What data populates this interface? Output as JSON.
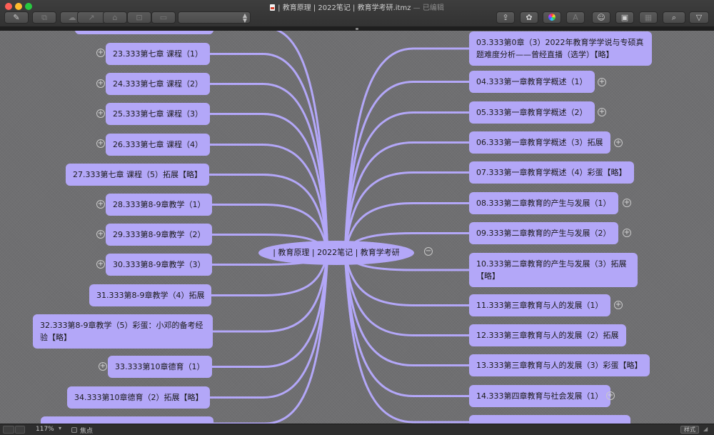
{
  "window": {
    "title": "| 教育原理 | 2022笔记 | 教育学考研.itmz",
    "edited": "— 已编辑"
  },
  "toolbar": {
    "left_icons": [
      "note-icon",
      "map-style-icon",
      "cloud-icon",
      "link-icon",
      "label-icon",
      "callout-icon",
      "comment-icon"
    ],
    "style_select_value": "",
    "right_icons": [
      "share-icon",
      "theme-icon",
      "color-wheel-icon",
      "font-icon",
      "emoji-icon",
      "image-icon",
      "table-icon",
      "search-icon",
      "filter-icon"
    ]
  },
  "mindmap": {
    "central": "| 教育原理 | 2022笔记 | 教育学考研",
    "left_topics": [
      {
        "text": "23.333第七章 课程（1）",
        "collapsed": true
      },
      {
        "text": "24.333第七章 课程（2）",
        "collapsed": true
      },
      {
        "text": "25.333第七章 课程（3）",
        "collapsed": true
      },
      {
        "text": "26.333第七章 课程（4）",
        "collapsed": true
      },
      {
        "text": "27.333第七章 课程（5）拓展【略】",
        "collapsed": false
      },
      {
        "text": "28.333第8-9章教学（1）",
        "collapsed": true
      },
      {
        "text": "29.333第8-9章教学（2）",
        "collapsed": true
      },
      {
        "text": "30.333第8-9章教学（3）",
        "collapsed": true
      },
      {
        "text": "31.333第8-9章教学（4）拓展",
        "collapsed": false
      },
      {
        "text": "32.333第8-9章教学（5）彩蛋：小邓的备考经验【略】",
        "collapsed": false
      },
      {
        "text": "33.333第10章德育（1）",
        "collapsed": true
      },
      {
        "text": "34.333第10章德育（2）拓展【略】",
        "collapsed": false
      }
    ],
    "right_topics": [
      {
        "text": "03.333第0章（3）2022年教育学学说与专硕真题难度分析——曾经直播（选学）【略】",
        "collapsed": false
      },
      {
        "text": "04.333第一章教育学概述（1）",
        "collapsed": true
      },
      {
        "text": "05.333第一章教育学概述（2）",
        "collapsed": true
      },
      {
        "text": "06.333第一章教育学概述（3）拓展",
        "collapsed": true
      },
      {
        "text": "07.333第一章教育学概述（4）彩蛋【略】",
        "collapsed": false
      },
      {
        "text": "08.333第二章教育的产生与发展（1）",
        "collapsed": true
      },
      {
        "text": "09.333第二章教育的产生与发展（2）",
        "collapsed": true
      },
      {
        "text": "10.333第二章教育的产生与发展（3）拓展【略】",
        "collapsed": false
      },
      {
        "text": "11.333第三章教育与人的发展（1）",
        "collapsed": true
      },
      {
        "text": "12.333第三章教育与人的发展（2）拓展",
        "collapsed": false
      },
      {
        "text": "13.333第三章教育与人的发展（3）彩蛋【略】",
        "collapsed": false
      },
      {
        "text": "14.333第四章教育与社会发展（1）",
        "collapsed": true
      }
    ],
    "branch_color": "#b3a7f8"
  },
  "statusbar": {
    "zoom": "117%",
    "focus_label": "焦点",
    "style_button": "样式"
  }
}
